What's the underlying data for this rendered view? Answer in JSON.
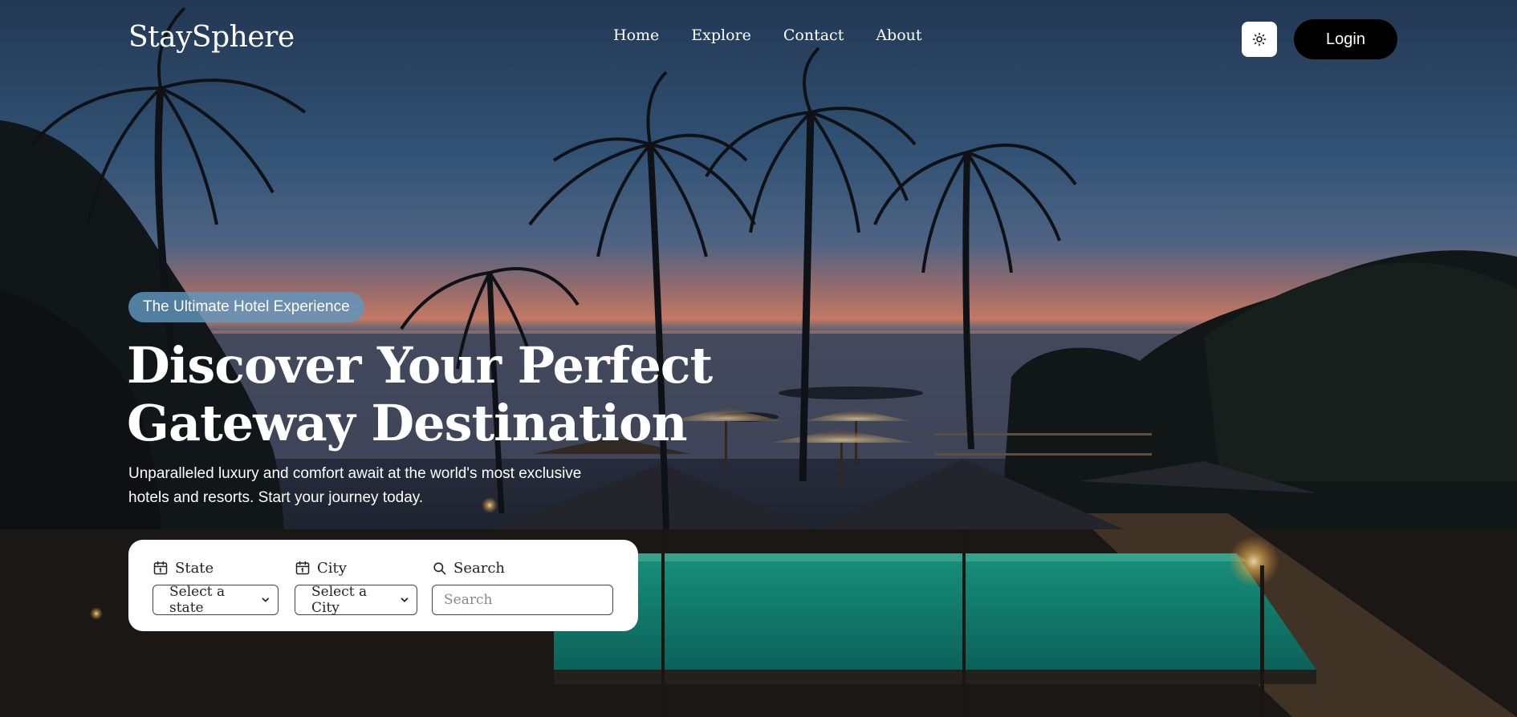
{
  "header": {
    "brand": "StaySphere",
    "nav": [
      {
        "label": "Home"
      },
      {
        "label": "Explore"
      },
      {
        "label": "Contact"
      },
      {
        "label": "About"
      }
    ],
    "theme_toggle_icon": "sun-icon",
    "login_label": "Login"
  },
  "hero": {
    "badge": "The Ultimate Hotel Experience",
    "headline_line1": "Discover Your Perfect",
    "headline_line2": "Gateway Destination",
    "subtext_line1": "Unparalleled luxury and comfort await at the world's most exclusive",
    "subtext_line2": "hotels and resorts. Start your journey today.",
    "background_scene": "tropical-resort-at-dusk-with-palm-trees-and-pool"
  },
  "search": {
    "state": {
      "label": "State",
      "icon": "calendar-icon",
      "value": "Select a state"
    },
    "city": {
      "label": "City",
      "icon": "calendar-icon",
      "value": "Select a City"
    },
    "query": {
      "label": "Search",
      "icon": "search-icon",
      "placeholder": "Search"
    }
  },
  "colors": {
    "badge_bg": "#5e96be",
    "login_bg": "#000000",
    "pool": "#1fb89a"
  }
}
